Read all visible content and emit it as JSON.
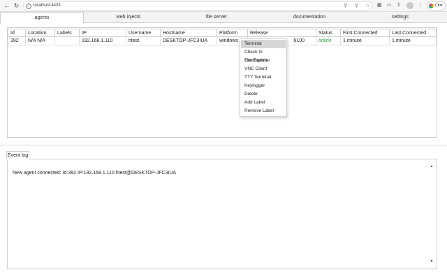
{
  "browser": {
    "url": "localhost:4433",
    "chat_label": "Chat"
  },
  "tabs": [
    {
      "label": "agents",
      "active": true
    },
    {
      "label": "web injects",
      "active": false
    },
    {
      "label": "file server",
      "active": false
    },
    {
      "label": "documentation",
      "active": false
    },
    {
      "label": "settings",
      "active": false
    }
  ],
  "agents_table": {
    "columns": [
      "Id",
      "Location",
      "Labels",
      "IP",
      "Username",
      "Hostname",
      "Platform",
      "Release",
      "Status",
      "First Connected",
      "Last Connected"
    ],
    "rows": [
      {
        "id": "392",
        "location": "N/A N/A",
        "labels": "",
        "ip": "192.168.1.110",
        "username": "htest",
        "hostname": "DESKTOP-JFC3IUA",
        "platform": "windows",
        "release": "6100",
        "status": "online",
        "first_connected": "1 minute",
        "last_connected": "1 minute"
      }
    ]
  },
  "context_menu": {
    "items": [
      "Terminal",
      "Check In Commands",
      "File Explorer",
      "VNC Client",
      "TTY Terminal",
      "Keylogger",
      "Delete",
      "Add Label",
      "Remove Label"
    ],
    "highlighted": "Terminal"
  },
  "event_log": {
    "tab_label": "Event log",
    "entries": [
      "New agent connected: Id:392 IP:192.168.1.110 htest@DESKTOP-JFC3IUA"
    ]
  },
  "colors": {
    "status_online": "#2e9e3a",
    "menu_highlight": "#d6d6d6",
    "border": "#cfcfcf"
  }
}
